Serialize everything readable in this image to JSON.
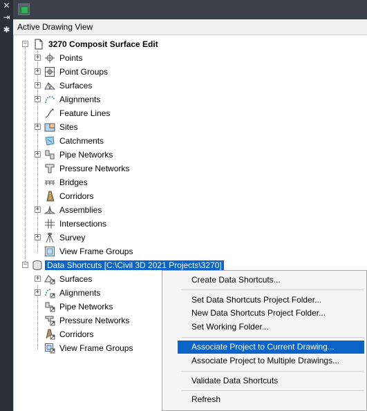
{
  "header": {
    "title": "Active Drawing View"
  },
  "tree": {
    "root": {
      "label": "3270 Composit Surface Edit"
    },
    "items": [
      {
        "label": "Points"
      },
      {
        "label": "Point Groups"
      },
      {
        "label": "Surfaces"
      },
      {
        "label": "Alignments"
      },
      {
        "label": "Feature Lines"
      },
      {
        "label": "Sites"
      },
      {
        "label": "Catchments"
      },
      {
        "label": "Pipe Networks"
      },
      {
        "label": "Pressure Networks"
      },
      {
        "label": "Bridges"
      },
      {
        "label": "Corridors"
      },
      {
        "label": "Assemblies"
      },
      {
        "label": "Intersections"
      },
      {
        "label": "Survey"
      },
      {
        "label": "View Frame Groups"
      }
    ],
    "data_shortcuts": {
      "label": "Data Shortcuts [C:\\Civil 3D 2021 Projects\\3270]"
    },
    "ds_items": [
      {
        "label": "Surfaces"
      },
      {
        "label": "Alignments"
      },
      {
        "label": "Pipe Networks"
      },
      {
        "label": "Pressure Networks"
      },
      {
        "label": "Corridors"
      },
      {
        "label": "View Frame Groups"
      }
    ]
  },
  "context_menu": {
    "items": [
      {
        "label": "Create Data Shortcuts..."
      },
      {
        "label": "Set Data Shortcuts Project Folder..."
      },
      {
        "label": "New Data Shortcuts Project Folder..."
      },
      {
        "label": "Set Working Folder..."
      },
      {
        "label": "Associate Project to Current Drawing..."
      },
      {
        "label": "Associate Project to Multiple Drawings..."
      },
      {
        "label": "Validate Data Shortcuts"
      },
      {
        "label": "Refresh"
      }
    ]
  },
  "colors": {
    "selection": "#0a64c8",
    "toolbar": "#3b4049",
    "sidebar": "#2b2f36"
  }
}
